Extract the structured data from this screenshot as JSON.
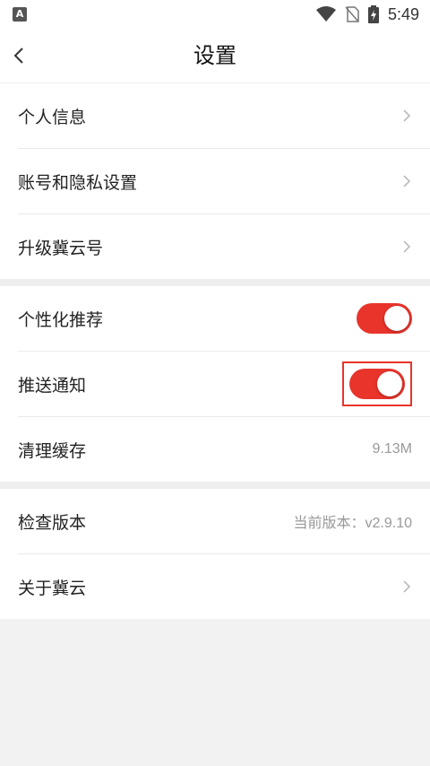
{
  "status_bar": {
    "app_badge": "A",
    "time": "5:49",
    "icons": [
      "wifi-icon",
      "no-sim-icon",
      "battery-charging-icon"
    ]
  },
  "header": {
    "title": "设置",
    "back_icon": "chevron-left-icon"
  },
  "section1": [
    {
      "label": "个人信息"
    },
    {
      "label": "账号和隐私设置"
    },
    {
      "label": "升级冀云号"
    }
  ],
  "section2": {
    "personalized": {
      "label": "个性化推荐",
      "on": true
    },
    "push": {
      "label": "推送通知",
      "on": true
    },
    "cache": {
      "label": "清理缓存",
      "value": "9.13M"
    }
  },
  "section3": {
    "version": {
      "label": "检查版本",
      "value": "当前版本：v2.9.10"
    },
    "about": {
      "label": "关于冀云"
    }
  },
  "colors": {
    "accent": "#e8342b",
    "background": "#f2f2f2"
  }
}
